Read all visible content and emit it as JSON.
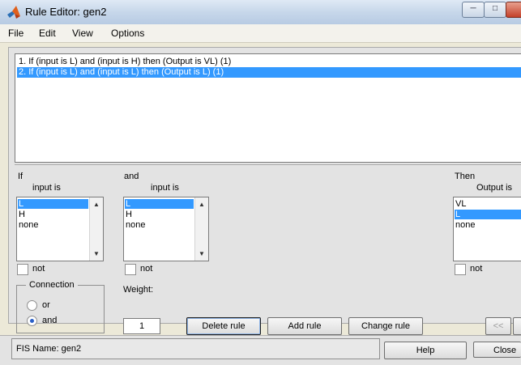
{
  "window": {
    "title": "Rule Editor: gen2"
  },
  "menu": [
    "File",
    "Edit",
    "View",
    "Options"
  ],
  "rules": [
    "1. If (input is L) and (input is H) then (Output is VL) (1)",
    "2. If (input is L) and (input is L) then (Output is L) (1)"
  ],
  "selected_rule_index": 1,
  "if_panel": {
    "title": "If",
    "subtitle": "input is",
    "options": [
      "L",
      "H",
      "none"
    ],
    "selected": "L",
    "not_label": "not"
  },
  "and_panel": {
    "title": "and",
    "subtitle": "input is",
    "options": [
      "L",
      "H",
      "none"
    ],
    "selected": "L",
    "not_label": "not"
  },
  "then_panel": {
    "title": "Then",
    "subtitle": "Output is",
    "options": [
      "VL",
      "L",
      "none"
    ],
    "selected": "L",
    "not_label": "not"
  },
  "connection": {
    "label": "Connection",
    "options": [
      "or",
      "and"
    ],
    "selected": "and"
  },
  "weight": {
    "label": "Weight:",
    "value": "1"
  },
  "buttons": {
    "delete": "Delete rule",
    "add": "Add rule",
    "change": "Change rule",
    "prev": "<<",
    "help": "Help",
    "close": "Close"
  },
  "status": {
    "text": "FIS Name: gen2"
  }
}
